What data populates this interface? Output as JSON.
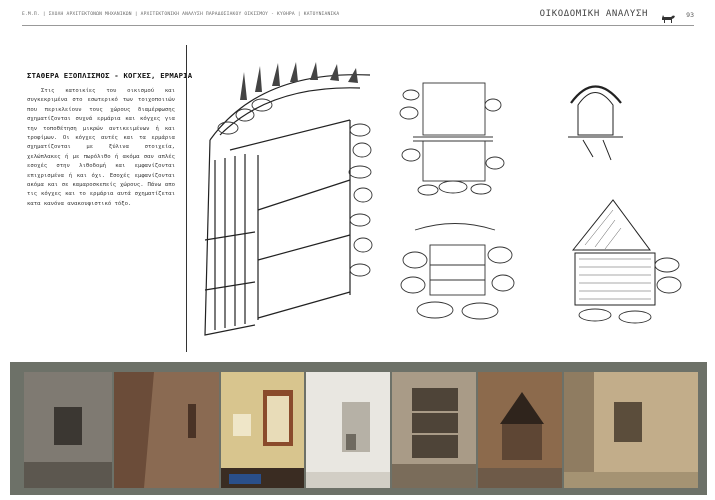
{
  "header": {
    "path": "Ε.Μ.Π.  |  ΣΧΟΛΗ ΑΡΧΙΤΕΚΤΟΝΩΝ ΜΗΧΑΝΙΚΩΝ  |  ΑΡΧΙΤΕΚΤΟΝΙΚΗ ΑΝΑΛΥΣΗ ΠΑΡΑΔΟΣΙΑΚΟΥ ΟΙΚΙΣΜΟΥ - ΚΥΘΗΡΑ  |  ΚΑΤΟΥΝΙΑΝΙΚΑ",
    "title": "ΟΙΚΟΔΟΜΙΚΗ ΑΝΑΛΥΣΗ",
    "icon": "goat-icon",
    "page_number": "93"
  },
  "section": {
    "title": "ΣΤΑΘΕΡΑ ΕΞΟΠΛΙΣΜΟΣ - ΚΟΓΧΕΣ, ΕΡΜΑΡΙΑ",
    "body": "Στις κατοικίες του οικισμού και συγκεκριμένα στο εσωτερικό των τοιχοποιιών που περικλείουν τους χώρους διαμέρφωσης σχηματίζονται συχνά ερμάρια και κόγχες για την τοποθέτηση μικρών αντικειμένων ή και τροφίμων. Οι κόγχες αυτές και τα ερμάρια σχηματίζονται με ξύλινα στοιχεία, χελώπλακες ή με πωρόλιθο ή ακόμα σαν απλές εσοχές στην λιθοδομή και εμφανίζονται επιχρισμένα ή και όχι. Εσοχές εμφανίζονται ακόμα και σε καμαροσκεπείς χώρους. Πάνω απο τις κόγχες και το ερμάρια αυτά σχηματίζεται κατα κανόνα ανακουφιστικό τόξο."
  },
  "sketches": [
    {
      "id": "cupboard-sketch"
    },
    {
      "id": "lintel-niche-sketch"
    },
    {
      "id": "arched-niche-sketch"
    },
    {
      "id": "stone-niche-sketch"
    },
    {
      "id": "gabled-niche-sketch"
    }
  ],
  "photos": [
    {
      "id": "plastered-niche-photo",
      "colors": [
        "#7f7a72",
        "#5c574f",
        "#3b3732"
      ]
    },
    {
      "id": "brown-wall-niche-photo",
      "colors": [
        "#8a6a52",
        "#6b4c39",
        "#4a3326"
      ]
    },
    {
      "id": "interior-cupboard-photo",
      "colors": [
        "#d8c58e",
        "#8a4b2b",
        "#3a2c22"
      ]
    },
    {
      "id": "white-niche-photo",
      "colors": [
        "#e9e7e1",
        "#b6b1a6",
        "#6f6a60"
      ]
    },
    {
      "id": "stone-cupboard-photo",
      "colors": [
        "#a99b87",
        "#7a6c5a",
        "#4e4438"
      ]
    },
    {
      "id": "gabled-niche-photo",
      "colors": [
        "#8c6a4c",
        "#5e4634",
        "#2f241c"
      ]
    },
    {
      "id": "ruined-wall-niche-photo",
      "colors": [
        "#c2ad8a",
        "#8f7c61",
        "#5b4d3b"
      ]
    }
  ]
}
